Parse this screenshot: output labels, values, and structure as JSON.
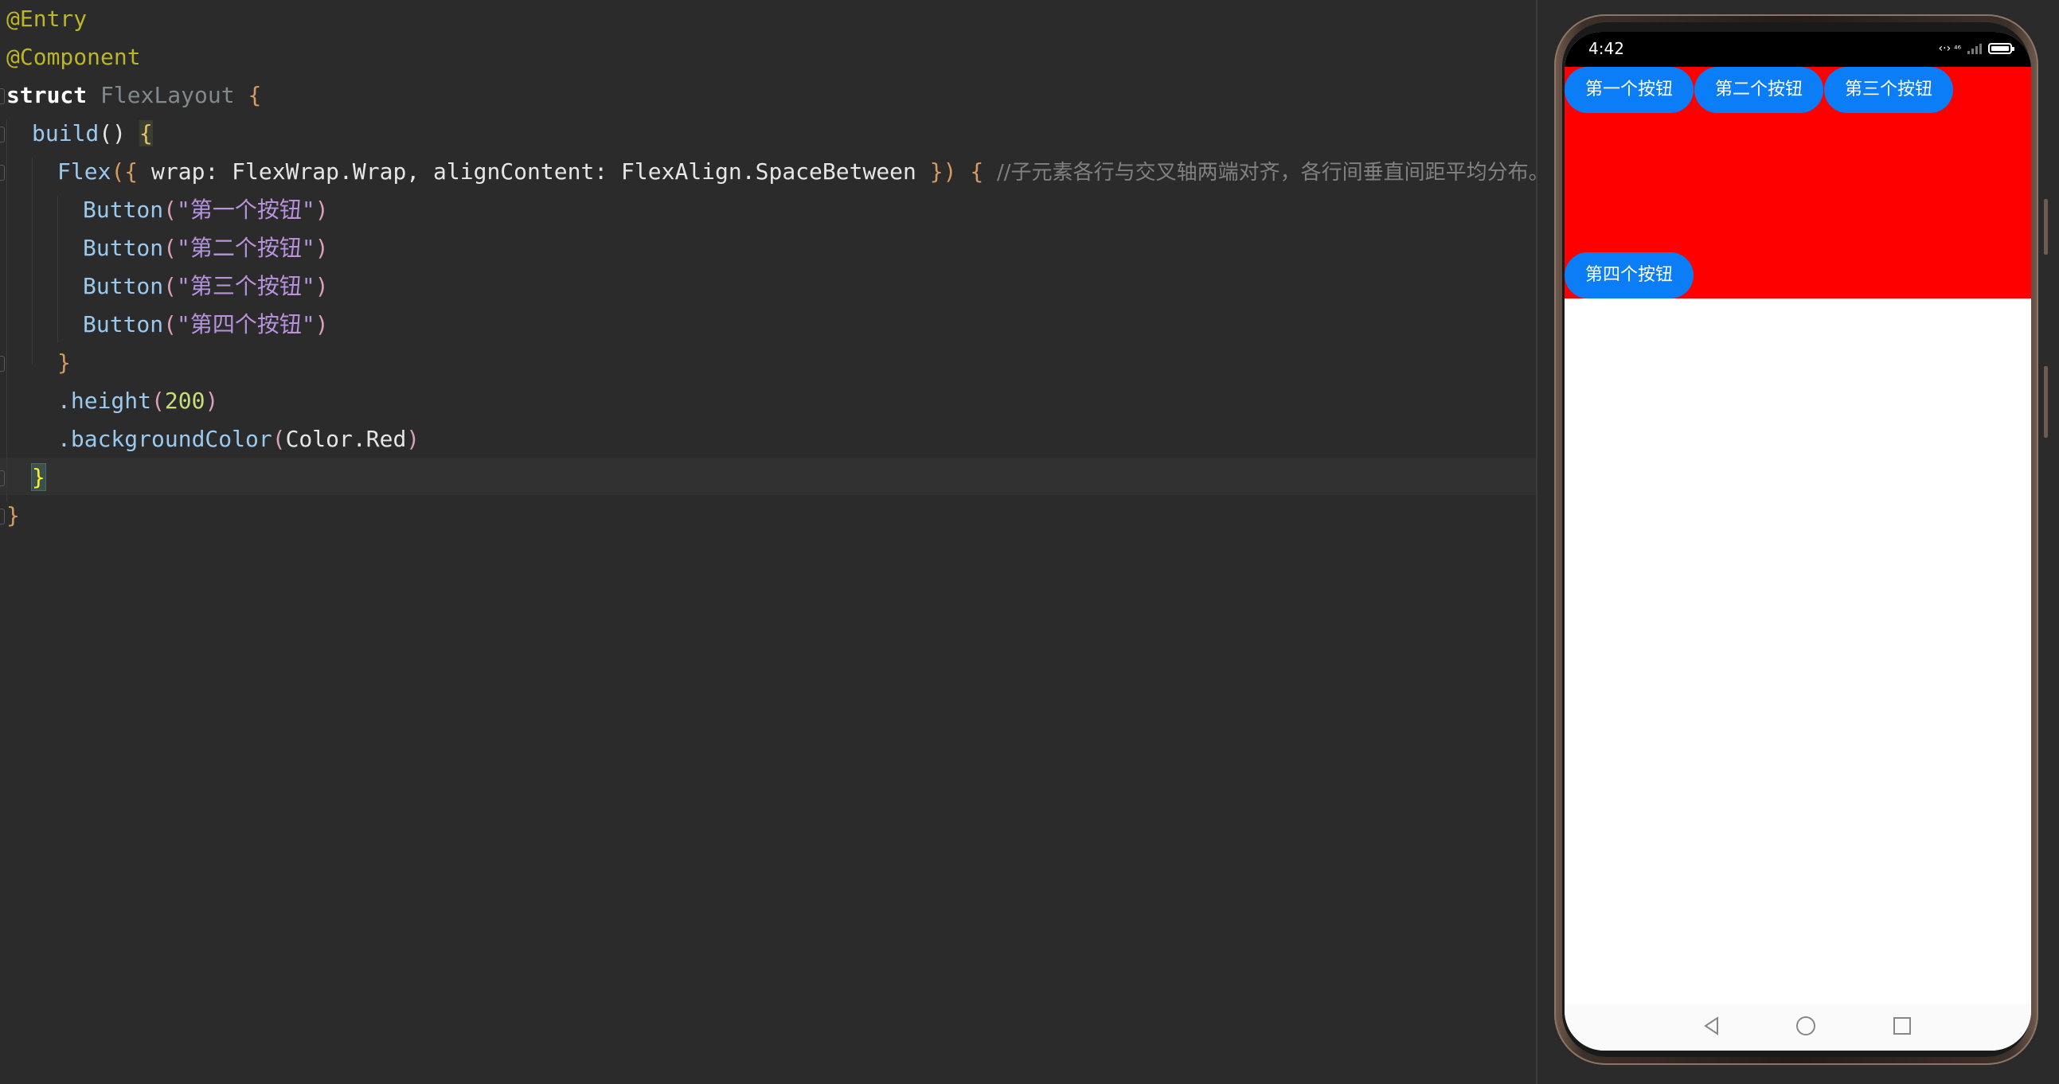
{
  "editor": {
    "lines": [
      {
        "annotation": "@Entry"
      },
      {
        "annotation": "@Component"
      },
      {
        "keyword": "struct",
        "name": " FlexLayout",
        "brace": " {"
      },
      {
        "fn": "build",
        "paren": "()",
        "brace": "{"
      },
      {
        "fn": "Flex",
        "open": "({ ",
        "args": "wrap: FlexWrap.Wrap, alignContent: FlexAlign.SpaceBetween ",
        "close": "})",
        "brace": "{",
        "comment": "//子元素各行与交叉轴两端对齐，各行间垂直间距平均分布。"
      },
      {
        "fn": "Button",
        "open": "(",
        "str": "\"第一个按钮\"",
        "close": ")"
      },
      {
        "fn": "Button",
        "open": "(",
        "str": "\"第二个按钮\"",
        "close": ")"
      },
      {
        "fn": "Button",
        "open": "(",
        "str": "\"第三个按钮\"",
        "close": ")"
      },
      {
        "fn": "Button",
        "open": "(",
        "str": "\"第四个按钮\"",
        "close": ")"
      },
      {
        "brace": "}"
      },
      {
        "fn": ".height",
        "open": "(",
        "num": "200",
        "close": ")"
      },
      {
        "fn": ".backgroundColor",
        "open": "(",
        "arg": "Color.Red",
        "close": ")"
      },
      {
        "brace": "}"
      },
      {
        "brace": "}"
      }
    ]
  },
  "preview": {
    "status_time": "4:42",
    "network_label": "‹·›",
    "signal_label": "⁴⁶",
    "buttons": [
      "第一个按钮",
      "第二个按钮",
      "第三个按钮",
      "第四个按钮"
    ],
    "container_color": "#ff0000",
    "button_color": "#0a7df7"
  }
}
